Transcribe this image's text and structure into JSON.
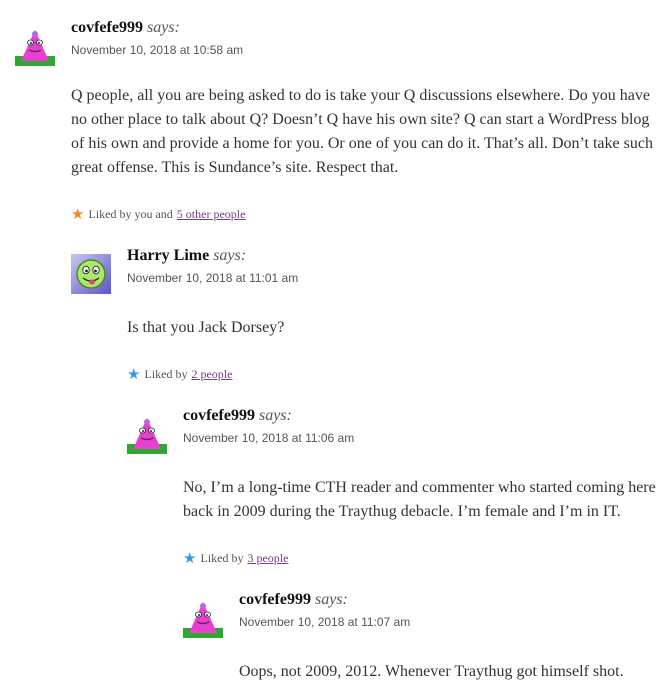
{
  "comments": [
    {
      "author": "covfefe999",
      "says": "says:",
      "date": "November 10, 2018 at 10:58 am",
      "body": "Q people, all you are being asked to do is take your Q discussions elsewhere. Do you have no other place to talk about Q? Doesn’t Q have his own site? Q can start a WordPress blog of his own and provide a home for you. Or one of you can do it. That’s all. Don’t take such great offense. This is Sundance’s site. Respect that.",
      "likes_prefix": "Liked by you and",
      "likes_link": "5 other people",
      "star_color": "#f08a24",
      "avatar": "pink-triangle-avatar"
    },
    {
      "author": "Harry Lime",
      "says": "says:",
      "date": "November 10, 2018 at 11:01 am",
      "body": "Is that you Jack Dorsey?",
      "likes_prefix": "Liked by",
      "likes_link": "2 people",
      "star_color": "#2e9fd9",
      "avatar": "green-face-avatar"
    },
    {
      "author": "covfefe999",
      "says": "says:",
      "date": "November 10, 2018 at 11:06 am",
      "body": "No, I’m a long-time CTH reader and commenter who started coming here back in 2009 during the Traythug debacle. I’m female and I’m in IT.",
      "likes_prefix": "Liked by",
      "likes_link": "3 people",
      "star_color": "#2e9fd9",
      "avatar": "pink-triangle-avatar"
    },
    {
      "author": "covfefe999",
      "says": "says:",
      "date": "November 10, 2018 at 11:07 am",
      "body": "Oops, not 2009, 2012. Whenever Traythug got himself shot.",
      "avatar": "pink-triangle-avatar"
    }
  ]
}
